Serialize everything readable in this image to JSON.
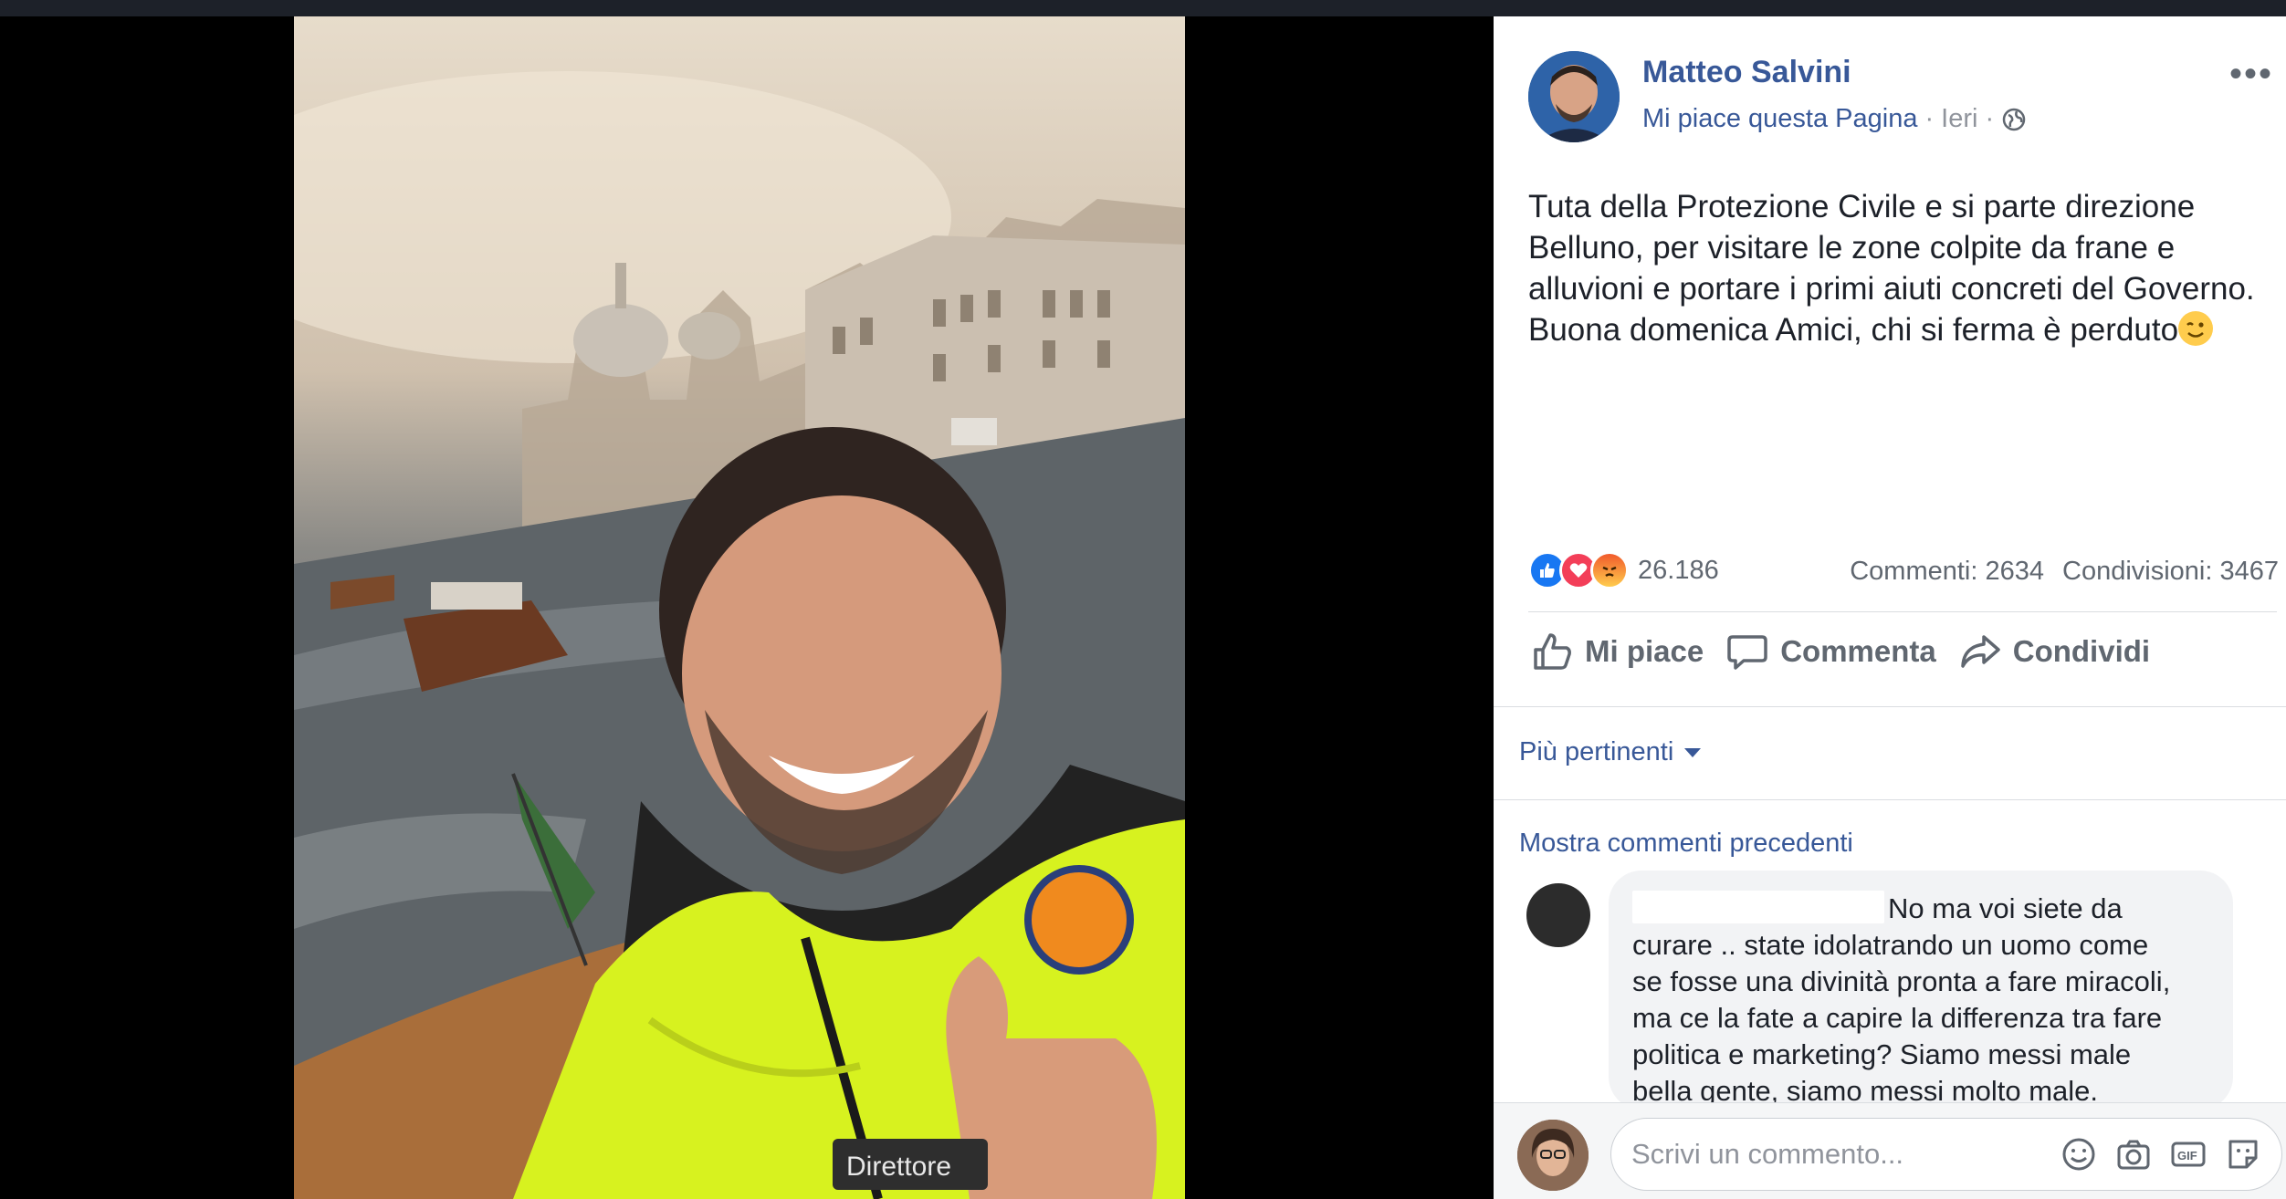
{
  "post": {
    "author": "Matteo Salvini",
    "like_page": "Mi piace questa Pagina",
    "separator1": "·",
    "time": "Ieri",
    "separator2": "·",
    "text_line1": "Tuta della Protezione Civile e si parte direzione",
    "text_line2": "Belluno, per visitare le zone colpite da frane e",
    "text_line3": "alluvioni e portare i primi aiuti concreti del Governo.",
    "text_line4": "Buona domenica Amici, chi si ferma è perduto",
    "reactions_count": "26.186",
    "comments_count": "Commenti: 2634",
    "shares_count": "Condivisioni: 3467"
  },
  "photo": {
    "jacket_label": "Direttore"
  },
  "actions": {
    "like": "Mi piace",
    "comment": "Commenta",
    "share": "Condividi"
  },
  "comments": {
    "sort_label": "Più pertinenti",
    "show_previous": "Mostra commenti precedenti",
    "items": [
      {
        "line1": "No ma voi siete da",
        "line2": "curare .. state idolatrando un uomo come",
        "line3": "se fosse una divinità pronta a fare miracoli,",
        "line4": "ma ce la fate a capire la differenza tra fare",
        "line5": "politica e marketing? Siamo messi male",
        "line6": "bella gente, siamo messi molto male."
      }
    ]
  },
  "composer": {
    "placeholder": "Scrivi un commento..."
  },
  "colors": {
    "link": "#385898",
    "secondary_text": "#606770",
    "like_blue": "#1877f2",
    "love_red": "#f33e58"
  },
  "icons": [
    "globe-icon",
    "more-icon",
    "like-icon",
    "comment-icon",
    "share-icon",
    "caret-down-icon",
    "emoji-icon",
    "camera-icon",
    "gif-icon",
    "sticker-icon"
  ]
}
